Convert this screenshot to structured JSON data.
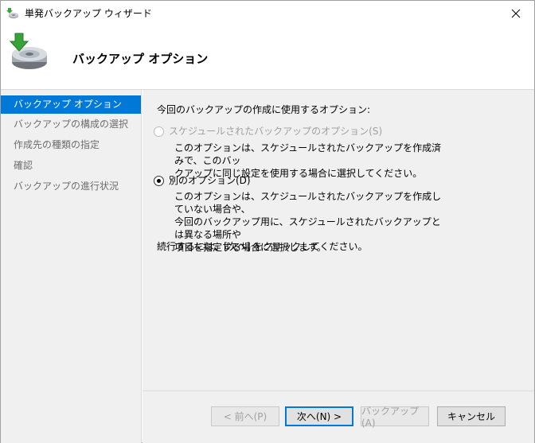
{
  "window": {
    "title": "単発バックアップ ウィザード"
  },
  "header": {
    "title": "バックアップ オプション"
  },
  "sidebar": {
    "items": [
      {
        "label": "バックアップ オプション",
        "active": true
      },
      {
        "label": "バックアップの構成の選択",
        "active": false
      },
      {
        "label": "作成先の種類の指定",
        "active": false
      },
      {
        "label": "確認",
        "active": false
      },
      {
        "label": "バックアップの進行状況",
        "active": false
      }
    ]
  },
  "main": {
    "intro": "今回のバックアップの作成に使用するオプション:",
    "option1": {
      "label": "スケジュールされたバックアップのオプション(S)",
      "desc_line1": "このオプションは、スケジュールされたバックアップを作成済みで、このバッ",
      "desc_line2": "クアップに同じ設定を使用する場合に選択してください。"
    },
    "option2": {
      "label": "別のオプション(D)",
      "desc_line1": "このオプションは、スケジュールされたバックアップを作成していない場合や、",
      "desc_line2": "今回のバックアップ用に、スケジュールされたバックアップとは異なる場所や",
      "desc_line3": "項目を指定する場合に選択します。"
    },
    "continue_text": "続行するには、[次へ] をクリックしてください。"
  },
  "footer": {
    "prev_label": "< 前へ(P)",
    "next_label": "次へ(N) >",
    "backup_label": "バックアップ(A)",
    "cancel_label": "キャンセル"
  },
  "colors": {
    "accent": "#0078d7",
    "panel": "#f0f0f0"
  }
}
